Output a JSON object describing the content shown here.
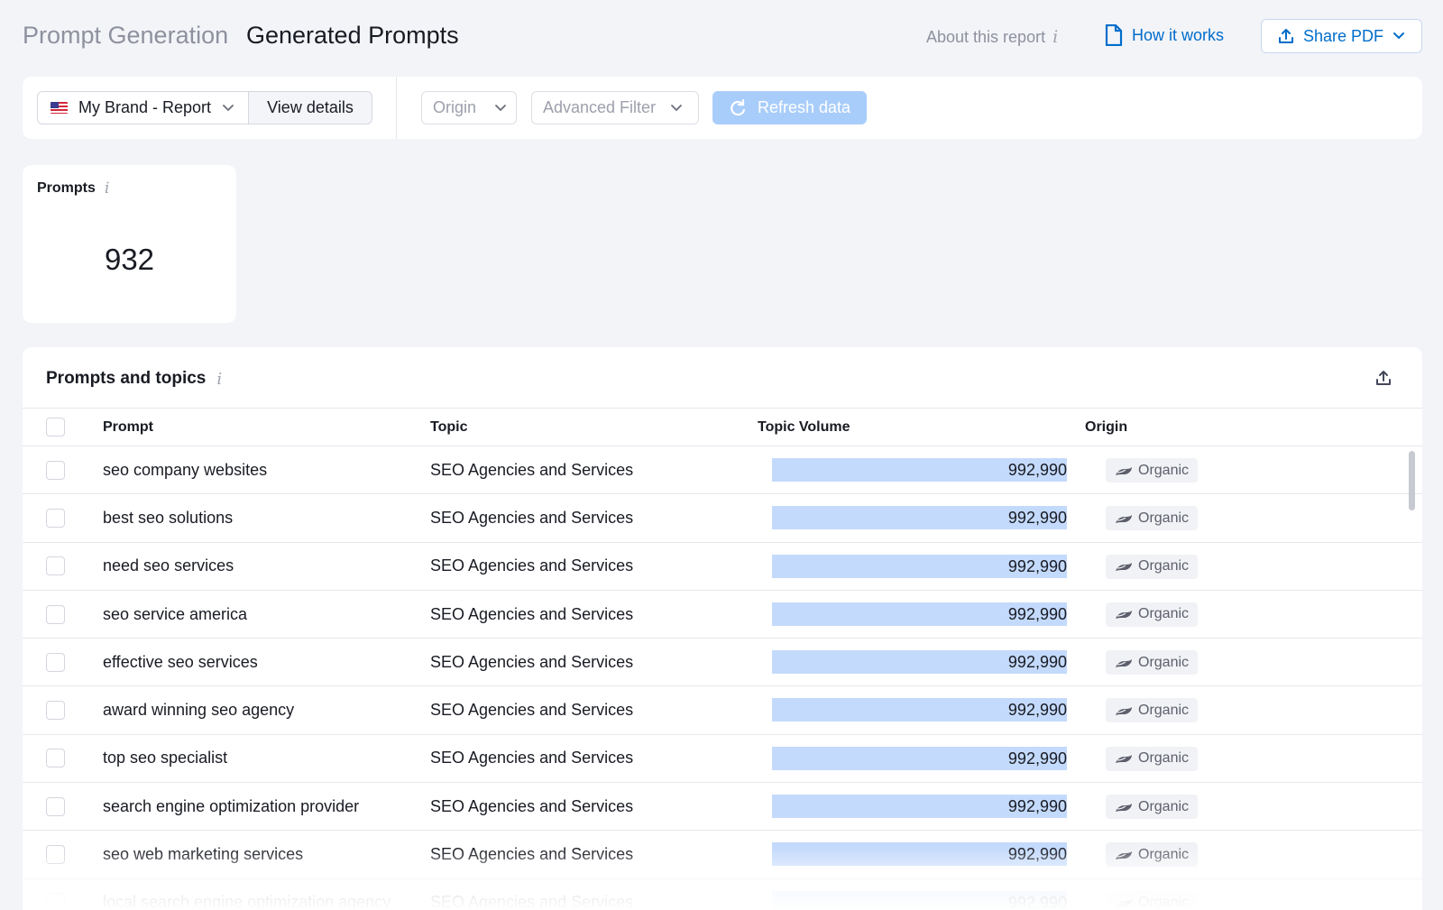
{
  "header": {
    "crumb": "Prompt Generation",
    "title": "Generated Prompts",
    "about": "About this report",
    "how": "How it works",
    "share": "Share PDF"
  },
  "filters": {
    "brand": "My Brand - Report",
    "view_details": "View details",
    "origin": "Origin",
    "advanced": "Advanced Filter",
    "refresh": "Refresh data"
  },
  "stat": {
    "label": "Prompts",
    "value": "932"
  },
  "table": {
    "title": "Prompts and topics",
    "columns": [
      "Prompt",
      "Topic",
      "Topic Volume",
      "Origin"
    ],
    "rows": [
      {
        "prompt": "seo company websites",
        "topic": "SEO Agencies and Services",
        "volume": "992,990",
        "origin": "Organic"
      },
      {
        "prompt": "best seo solutions",
        "topic": "SEO Agencies and Services",
        "volume": "992,990",
        "origin": "Organic"
      },
      {
        "prompt": "need seo services",
        "topic": "SEO Agencies and Services",
        "volume": "992,990",
        "origin": "Organic"
      },
      {
        "prompt": "seo service america",
        "topic": "SEO Agencies and Services",
        "volume": "992,990",
        "origin": "Organic"
      },
      {
        "prompt": "effective seo services",
        "topic": "SEO Agencies and Services",
        "volume": "992,990",
        "origin": "Organic"
      },
      {
        "prompt": "award winning seo agency",
        "topic": "SEO Agencies and Services",
        "volume": "992,990",
        "origin": "Organic"
      },
      {
        "prompt": "top seo specialist",
        "topic": "SEO Agencies and Services",
        "volume": "992,990",
        "origin": "Organic"
      },
      {
        "prompt": "search engine optimization provider",
        "topic": "SEO Agencies and Services",
        "volume": "992,990",
        "origin": "Organic"
      },
      {
        "prompt": "seo web marketing services",
        "topic": "SEO Agencies and Services",
        "volume": "992,990",
        "origin": "Organic"
      },
      {
        "prompt": "local search engine optimization agency",
        "topic": "SEO Agencies and Services",
        "volume": "992,990",
        "origin": "Organic"
      }
    ]
  },
  "colors": {
    "accent": "#006dca",
    "bar": "#c4dafc",
    "refresh_bg": "#a9cdfa",
    "page_bg": "#f3f4f8"
  },
  "icons": [
    "info-icon",
    "document-icon",
    "upload-icon",
    "chevron-down-icon",
    "flag-us-icon",
    "refresh-icon",
    "export-icon",
    "organic-icon"
  ]
}
